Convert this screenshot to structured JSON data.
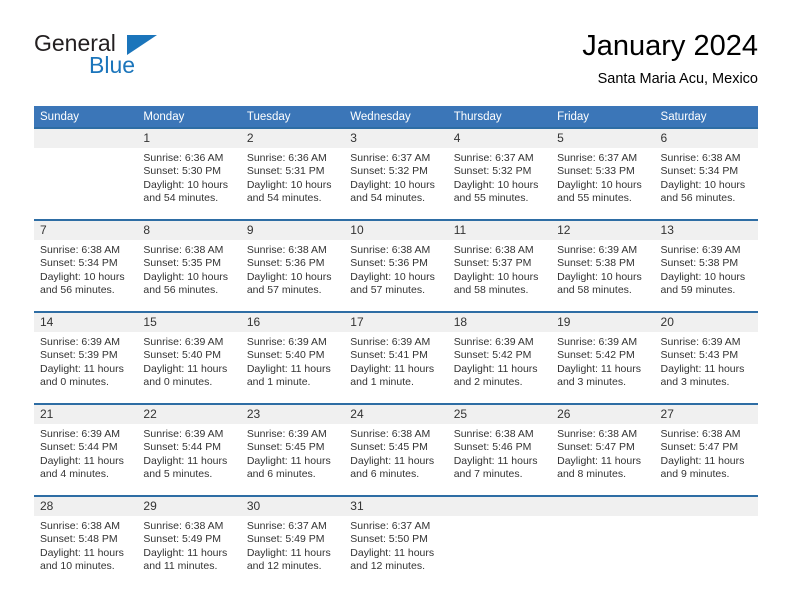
{
  "brand": {
    "name_part1": "General",
    "name_part2": "Blue",
    "triangle_color": "#1b75bb"
  },
  "header": {
    "title": "January 2024",
    "subtitle": "Santa Maria Acu, Mexico"
  },
  "theme": {
    "header_row_bg": "#3b76b8",
    "week_separator": "#2e6da4",
    "daynum_band_bg": "#f0f0f0",
    "text_color": "#333333"
  },
  "weekdays": [
    "Sunday",
    "Monday",
    "Tuesday",
    "Wednesday",
    "Thursday",
    "Friday",
    "Saturday"
  ],
  "weeks": [
    [
      {
        "day": "",
        "blank": true,
        "sunrise": "",
        "sunset": "",
        "daylight1": "",
        "daylight2": ""
      },
      {
        "day": "1",
        "sunrise": "Sunrise: 6:36 AM",
        "sunset": "Sunset: 5:30 PM",
        "daylight1": "Daylight: 10 hours",
        "daylight2": "and 54 minutes."
      },
      {
        "day": "2",
        "sunrise": "Sunrise: 6:36 AM",
        "sunset": "Sunset: 5:31 PM",
        "daylight1": "Daylight: 10 hours",
        "daylight2": "and 54 minutes."
      },
      {
        "day": "3",
        "sunrise": "Sunrise: 6:37 AM",
        "sunset": "Sunset: 5:32 PM",
        "daylight1": "Daylight: 10 hours",
        "daylight2": "and 54 minutes."
      },
      {
        "day": "4",
        "sunrise": "Sunrise: 6:37 AM",
        "sunset": "Sunset: 5:32 PM",
        "daylight1": "Daylight: 10 hours",
        "daylight2": "and 55 minutes."
      },
      {
        "day": "5",
        "sunrise": "Sunrise: 6:37 AM",
        "sunset": "Sunset: 5:33 PM",
        "daylight1": "Daylight: 10 hours",
        "daylight2": "and 55 minutes."
      },
      {
        "day": "6",
        "sunrise": "Sunrise: 6:38 AM",
        "sunset": "Sunset: 5:34 PM",
        "daylight1": "Daylight: 10 hours",
        "daylight2": "and 56 minutes."
      }
    ],
    [
      {
        "day": "7",
        "sunrise": "Sunrise: 6:38 AM",
        "sunset": "Sunset: 5:34 PM",
        "daylight1": "Daylight: 10 hours",
        "daylight2": "and 56 minutes."
      },
      {
        "day": "8",
        "sunrise": "Sunrise: 6:38 AM",
        "sunset": "Sunset: 5:35 PM",
        "daylight1": "Daylight: 10 hours",
        "daylight2": "and 56 minutes."
      },
      {
        "day": "9",
        "sunrise": "Sunrise: 6:38 AM",
        "sunset": "Sunset: 5:36 PM",
        "daylight1": "Daylight: 10 hours",
        "daylight2": "and 57 minutes."
      },
      {
        "day": "10",
        "sunrise": "Sunrise: 6:38 AM",
        "sunset": "Sunset: 5:36 PM",
        "daylight1": "Daylight: 10 hours",
        "daylight2": "and 57 minutes."
      },
      {
        "day": "11",
        "sunrise": "Sunrise: 6:38 AM",
        "sunset": "Sunset: 5:37 PM",
        "daylight1": "Daylight: 10 hours",
        "daylight2": "and 58 minutes."
      },
      {
        "day": "12",
        "sunrise": "Sunrise: 6:39 AM",
        "sunset": "Sunset: 5:38 PM",
        "daylight1": "Daylight: 10 hours",
        "daylight2": "and 58 minutes."
      },
      {
        "day": "13",
        "sunrise": "Sunrise: 6:39 AM",
        "sunset": "Sunset: 5:38 PM",
        "daylight1": "Daylight: 10 hours",
        "daylight2": "and 59 minutes."
      }
    ],
    [
      {
        "day": "14",
        "sunrise": "Sunrise: 6:39 AM",
        "sunset": "Sunset: 5:39 PM",
        "daylight1": "Daylight: 11 hours",
        "daylight2": "and 0 minutes."
      },
      {
        "day": "15",
        "sunrise": "Sunrise: 6:39 AM",
        "sunset": "Sunset: 5:40 PM",
        "daylight1": "Daylight: 11 hours",
        "daylight2": "and 0 minutes."
      },
      {
        "day": "16",
        "sunrise": "Sunrise: 6:39 AM",
        "sunset": "Sunset: 5:40 PM",
        "daylight1": "Daylight: 11 hours",
        "daylight2": "and 1 minute."
      },
      {
        "day": "17",
        "sunrise": "Sunrise: 6:39 AM",
        "sunset": "Sunset: 5:41 PM",
        "daylight1": "Daylight: 11 hours",
        "daylight2": "and 1 minute."
      },
      {
        "day": "18",
        "sunrise": "Sunrise: 6:39 AM",
        "sunset": "Sunset: 5:42 PM",
        "daylight1": "Daylight: 11 hours",
        "daylight2": "and 2 minutes."
      },
      {
        "day": "19",
        "sunrise": "Sunrise: 6:39 AM",
        "sunset": "Sunset: 5:42 PM",
        "daylight1": "Daylight: 11 hours",
        "daylight2": "and 3 minutes."
      },
      {
        "day": "20",
        "sunrise": "Sunrise: 6:39 AM",
        "sunset": "Sunset: 5:43 PM",
        "daylight1": "Daylight: 11 hours",
        "daylight2": "and 3 minutes."
      }
    ],
    [
      {
        "day": "21",
        "sunrise": "Sunrise: 6:39 AM",
        "sunset": "Sunset: 5:44 PM",
        "daylight1": "Daylight: 11 hours",
        "daylight2": "and 4 minutes."
      },
      {
        "day": "22",
        "sunrise": "Sunrise: 6:39 AM",
        "sunset": "Sunset: 5:44 PM",
        "daylight1": "Daylight: 11 hours",
        "daylight2": "and 5 minutes."
      },
      {
        "day": "23",
        "sunrise": "Sunrise: 6:39 AM",
        "sunset": "Sunset: 5:45 PM",
        "daylight1": "Daylight: 11 hours",
        "daylight2": "and 6 minutes."
      },
      {
        "day": "24",
        "sunrise": "Sunrise: 6:38 AM",
        "sunset": "Sunset: 5:45 PM",
        "daylight1": "Daylight: 11 hours",
        "daylight2": "and 6 minutes."
      },
      {
        "day": "25",
        "sunrise": "Sunrise: 6:38 AM",
        "sunset": "Sunset: 5:46 PM",
        "daylight1": "Daylight: 11 hours",
        "daylight2": "and 7 minutes."
      },
      {
        "day": "26",
        "sunrise": "Sunrise: 6:38 AM",
        "sunset": "Sunset: 5:47 PM",
        "daylight1": "Daylight: 11 hours",
        "daylight2": "and 8 minutes."
      },
      {
        "day": "27",
        "sunrise": "Sunrise: 6:38 AM",
        "sunset": "Sunset: 5:47 PM",
        "daylight1": "Daylight: 11 hours",
        "daylight2": "and 9 minutes."
      }
    ],
    [
      {
        "day": "28",
        "sunrise": "Sunrise: 6:38 AM",
        "sunset": "Sunset: 5:48 PM",
        "daylight1": "Daylight: 11 hours",
        "daylight2": "and 10 minutes."
      },
      {
        "day": "29",
        "sunrise": "Sunrise: 6:38 AM",
        "sunset": "Sunset: 5:49 PM",
        "daylight1": "Daylight: 11 hours",
        "daylight2": "and 11 minutes."
      },
      {
        "day": "30",
        "sunrise": "Sunrise: 6:37 AM",
        "sunset": "Sunset: 5:49 PM",
        "daylight1": "Daylight: 11 hours",
        "daylight2": "and 12 minutes."
      },
      {
        "day": "31",
        "sunrise": "Sunrise: 6:37 AM",
        "sunset": "Sunset: 5:50 PM",
        "daylight1": "Daylight: 11 hours",
        "daylight2": "and 12 minutes."
      },
      {
        "day": "",
        "blank": true,
        "sunrise": "",
        "sunset": "",
        "daylight1": "",
        "daylight2": ""
      },
      {
        "day": "",
        "blank": true,
        "sunrise": "",
        "sunset": "",
        "daylight1": "",
        "daylight2": ""
      },
      {
        "day": "",
        "blank": true,
        "sunrise": "",
        "sunset": "",
        "daylight1": "",
        "daylight2": ""
      }
    ]
  ]
}
